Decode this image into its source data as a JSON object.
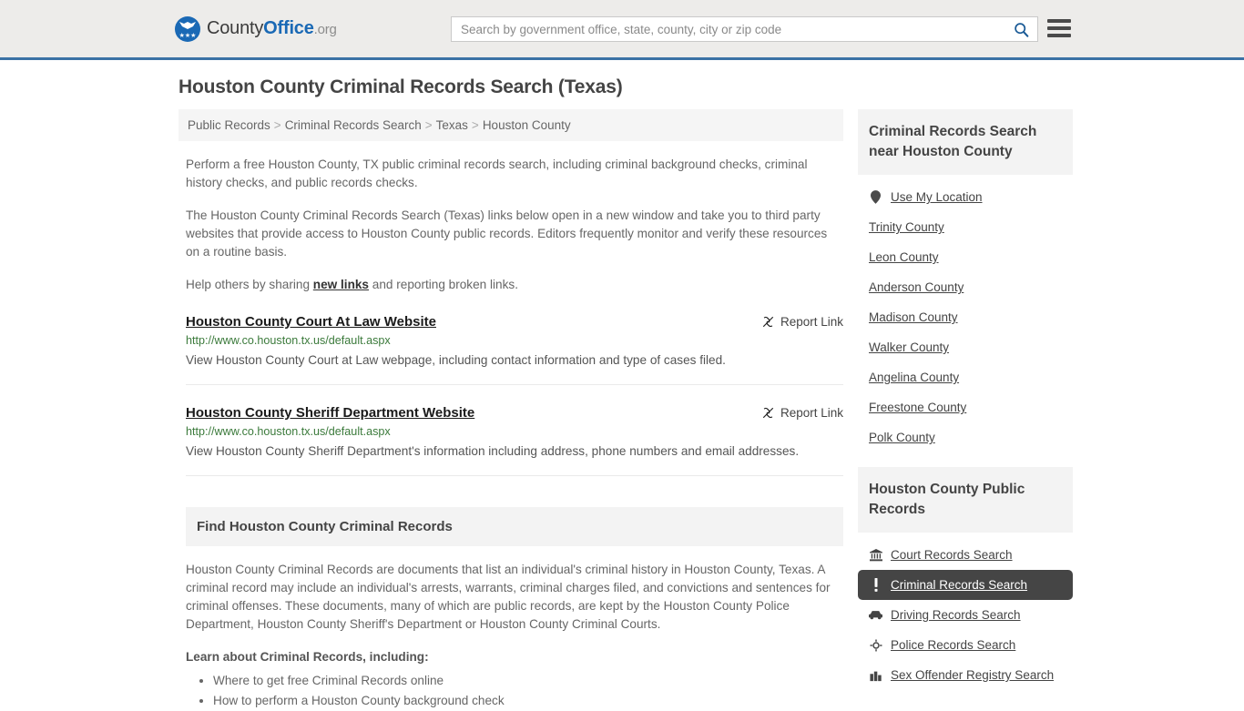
{
  "header": {
    "logo": {
      "part1": "County",
      "part2": "Office",
      "part3": ".org",
      "stars": "★★★"
    },
    "search": {
      "placeholder": "Search by government office, state, county, city or zip code",
      "value": "",
      "icon": "search-icon"
    },
    "menu_icon": "hamburger-menu-icon",
    "border_color": "#3b72a5",
    "background_color": "#edecea"
  },
  "page": {
    "title": "Houston County Criminal Records Search (Texas)"
  },
  "breadcrumb": {
    "items": [
      {
        "label": "Public Records"
      },
      {
        "label": "Criminal Records Search"
      },
      {
        "label": "Texas"
      },
      {
        "label": "Houston County"
      }
    ],
    "separator": ">"
  },
  "intro": {
    "p1": "Perform a free Houston County, TX public criminal records search, including criminal background checks, criminal history checks, and public records checks.",
    "p2": "The Houston County Criminal Records Search (Texas) links below open in a new window and take you to third party websites that provide access to Houston County public records. Editors frequently monitor and verify these resources on a routine basis.",
    "p3_before": "Help others by sharing ",
    "p3_link": "new links",
    "p3_after": " and reporting broken links."
  },
  "results": [
    {
      "title": "Houston County Court At Law Website",
      "url": "http://www.co.houston.tx.us/default.aspx",
      "description": "View Houston County Court at Law webpage, including contact information and type of cases filed.",
      "report_label": "Report Link",
      "report_icon": "broken-link-icon"
    },
    {
      "title": "Houston County Sheriff Department Website",
      "url": "http://www.co.houston.tx.us/default.aspx",
      "description": "View Houston County Sheriff Department's information including address, phone numbers and email addresses.",
      "report_label": "Report Link",
      "report_icon": "broken-link-icon"
    }
  ],
  "find_section": {
    "heading": "Find Houston County Criminal Records",
    "body": "Houston County Criminal Records are documents that list an individual's criminal history in Houston County, Texas. A criminal record may include an individual's arrests, warrants, criminal charges filed, and convictions and sentences for criminal offenses. These documents, many of which are public records, are kept by the Houston County Police Department, Houston County Sheriff's Department or Houston County Criminal Courts.",
    "lead_in": "Learn about Criminal Records, including:",
    "bullets": [
      "Where to get free Criminal Records online",
      "How to perform a Houston County background check"
    ]
  },
  "sidebar": {
    "nearby": {
      "heading": "Criminal Records Search near Houston County",
      "items": [
        {
          "label": "Use My Location",
          "icon": "map-pin-icon",
          "has_icon": true
        },
        {
          "label": "Trinity County",
          "icon": "",
          "has_icon": false
        },
        {
          "label": "Leon County",
          "icon": "",
          "has_icon": false
        },
        {
          "label": "Anderson County",
          "icon": "",
          "has_icon": false
        },
        {
          "label": "Madison County",
          "icon": "",
          "has_icon": false
        },
        {
          "label": "Walker County",
          "icon": "",
          "has_icon": false
        },
        {
          "label": "Angelina County",
          "icon": "",
          "has_icon": false
        },
        {
          "label": "Freestone County",
          "icon": "",
          "has_icon": false
        },
        {
          "label": "Polk County",
          "icon": "",
          "has_icon": false
        }
      ]
    },
    "public_records": {
      "heading": "Houston County Public Records",
      "active_color": "#454545",
      "items": [
        {
          "label": "Court Records Search",
          "icon": "courthouse-icon",
          "active": false
        },
        {
          "label": "Criminal Records Search",
          "icon": "exclamation-icon",
          "active": true
        },
        {
          "label": "Driving Records Search",
          "icon": "car-icon",
          "active": false
        },
        {
          "label": "Police Records Search",
          "icon": "police-badge-icon",
          "active": false
        },
        {
          "label": "Sex Offender Registry Search",
          "icon": "building-icon",
          "active": false
        }
      ]
    }
  }
}
